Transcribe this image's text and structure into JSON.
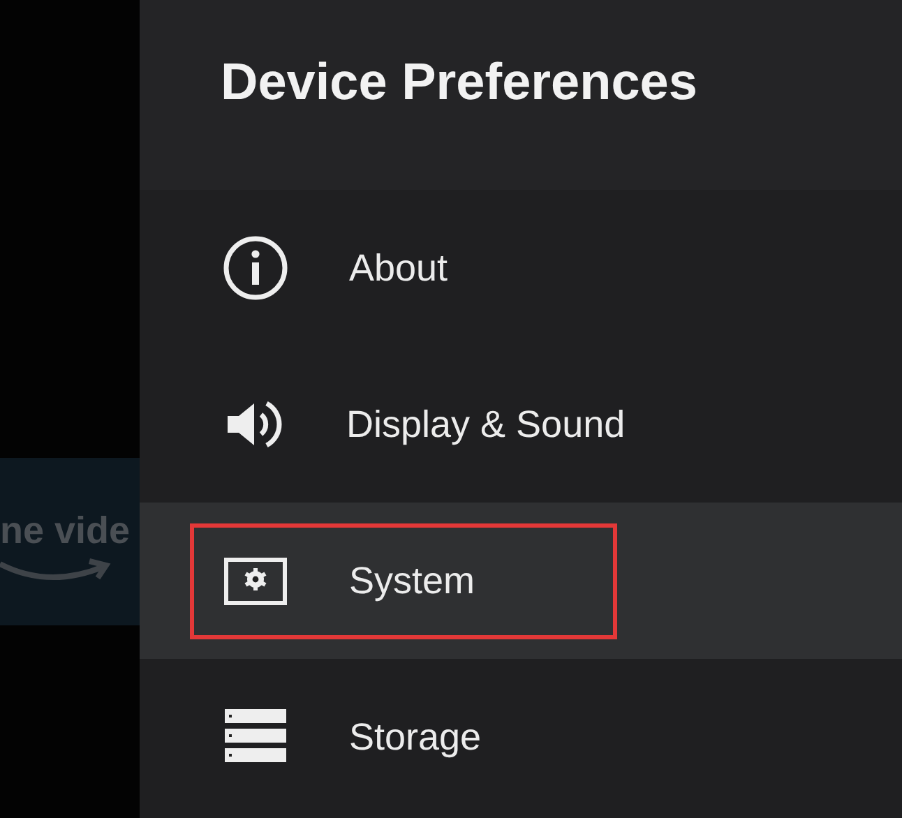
{
  "background_tile": {
    "label": "ne vide"
  },
  "panel": {
    "title": "Device Preferences",
    "items": [
      {
        "label": "About",
        "selected": false,
        "highlighted": false
      },
      {
        "label": "Display & Sound",
        "selected": false,
        "highlighted": false
      },
      {
        "label": "System",
        "selected": true,
        "highlighted": true
      },
      {
        "label": "Storage",
        "selected": false,
        "highlighted": false
      }
    ]
  }
}
